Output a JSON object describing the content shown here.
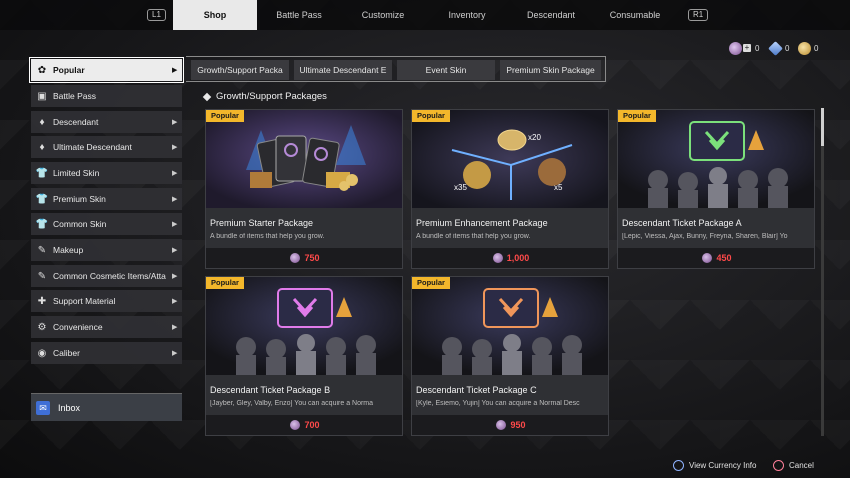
{
  "nav": {
    "left_shoulder": "L1",
    "right_shoulder": "R1",
    "tabs": [
      {
        "label": "Shop"
      },
      {
        "label": "Battle Pass"
      },
      {
        "label": "Customize"
      },
      {
        "label": "Inventory"
      },
      {
        "label": "Descendant"
      },
      {
        "label": "Consumable"
      }
    ],
    "active_tab": "Shop"
  },
  "currency": [
    {
      "icon": "caliber-icon",
      "value": "0",
      "color": "#b58ad6"
    },
    {
      "icon": "crystal-icon",
      "value": "0",
      "color": "#8fb7ff"
    },
    {
      "icon": "gold-coin-icon",
      "value": "0",
      "color": "#d8b45a"
    }
  ],
  "sidebar": {
    "items": [
      {
        "label": "Popular",
        "icon": "popular-icon",
        "glyph": "✿",
        "active": true
      },
      {
        "label": "Battle Pass",
        "icon": "battle-pass-icon",
        "glyph": "▣",
        "active": false
      },
      {
        "label": "Descendant",
        "icon": "descendant-icon",
        "glyph": "♦",
        "active": false
      },
      {
        "label": "Ultimate Descendant",
        "icon": "ultimate-descendant-icon",
        "glyph": "♦",
        "active": false
      },
      {
        "label": "Limited Skin",
        "icon": "shirt-icon",
        "glyph": "👕",
        "active": false
      },
      {
        "label": "Premium Skin",
        "icon": "shirt-icon",
        "glyph": "👕",
        "active": false
      },
      {
        "label": "Common Skin",
        "icon": "shirt-icon",
        "glyph": "👕",
        "active": false
      },
      {
        "label": "Makeup",
        "icon": "makeup-icon",
        "glyph": "✎",
        "active": false
      },
      {
        "label": "Common Cosmetic Items/Atta",
        "icon": "cosmetic-icon",
        "glyph": "✎",
        "active": false
      },
      {
        "label": "Support Material",
        "icon": "support-material-icon",
        "glyph": "✚",
        "active": false
      },
      {
        "label": "Convenience",
        "icon": "convenience-icon",
        "glyph": "⚙",
        "active": false
      },
      {
        "label": "Caliber",
        "icon": "caliber-icon",
        "glyph": "◉",
        "active": false
      }
    ],
    "inbox_label": "Inbox"
  },
  "subtabs": [
    {
      "label": "Growth/Support Packa"
    },
    {
      "label": "Ultimate Descendant E"
    },
    {
      "label": "Event Skin"
    },
    {
      "label": "Premium Skin Package"
    }
  ],
  "section_title": "Growth/Support Packages",
  "cards": [
    {
      "tag": "Popular",
      "name": "Premium Starter Package",
      "desc": "A bundle of items that help you grow.",
      "price": "750",
      "art": "cards"
    },
    {
      "tag": "Popular",
      "name": "Premium Enhancement Package",
      "desc": "A bundle of items that help you grow.",
      "price": "1,000",
      "art": "enhance",
      "badges": [
        "x20",
        "x35",
        "x5"
      ]
    },
    {
      "tag": "Popular",
      "name": "Descendant Ticket Package A",
      "desc": "[Lepic, Viessa, Ajax, Bunny, Freyna, Sharen, Blair] Yo",
      "price": "450",
      "art": "ticket",
      "emblem": "#7be07b"
    },
    {
      "tag": "Popular",
      "name": "Descendant Ticket Package B",
      "desc": "[Jayber, Gley, Valby, Enzo] You can acquire a Norma",
      "price": "700",
      "art": "ticket",
      "emblem": "#e07bea"
    },
    {
      "tag": "Popular",
      "name": "Descendant Ticket Package C",
      "desc": "[Kyle, Esiemo, Yujin] You can acquire a Normal Desc",
      "price": "950",
      "art": "ticket",
      "emblem": "#f0965a"
    }
  ],
  "bottom_hints": [
    {
      "icon": "circle-button-icon",
      "label": "View Currency Info"
    },
    {
      "icon": "cross-button-icon",
      "label": "Cancel"
    }
  ]
}
